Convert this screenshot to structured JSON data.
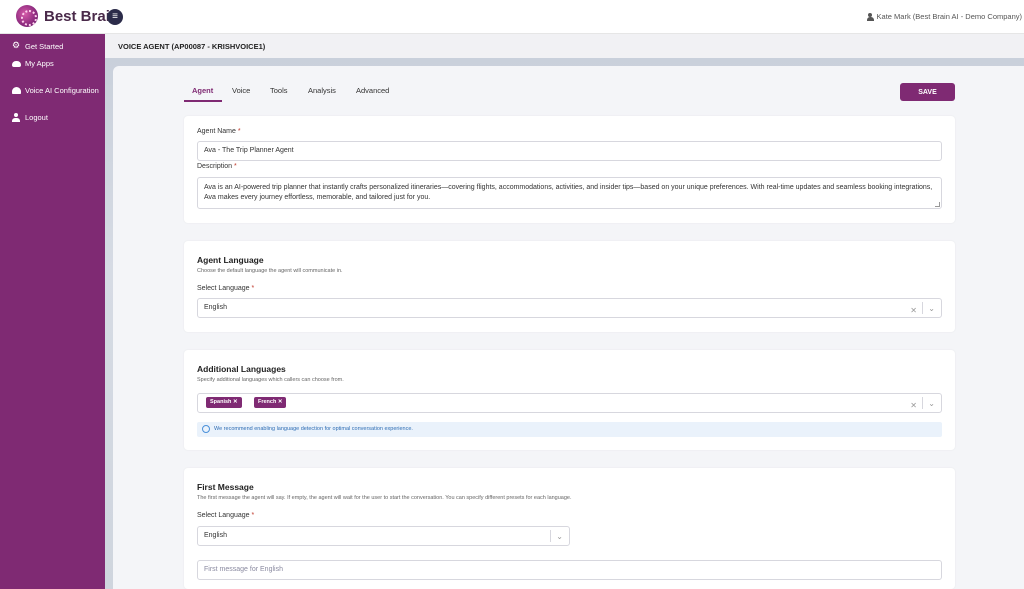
{
  "app": {
    "brand": "Best Brain",
    "user": "Kate Mark (Best Brain AI - Demo Company)"
  },
  "sidebar": {
    "items": [
      {
        "label": "Get Started",
        "icon": "gears-icon"
      },
      {
        "label": "My Apps",
        "icon": "apps-icon"
      },
      {
        "label": "Voice AI Configuration",
        "icon": "voice-icon"
      },
      {
        "label": "Logout",
        "icon": "user-icon"
      }
    ]
  },
  "header": {
    "title": "VOICE AGENT (AP00087 - KRISHVOICE1)"
  },
  "tabs": [
    {
      "label": "Agent",
      "active": true
    },
    {
      "label": "Voice"
    },
    {
      "label": "Tools"
    },
    {
      "label": "Analysis"
    },
    {
      "label": "Advanced"
    }
  ],
  "toolbar": {
    "save_label": "SAVE"
  },
  "agent": {
    "name_label": "Agent Name",
    "name_value": "Ava - The Trip  Planner Agent",
    "description_label": "Description",
    "description_value": "Ava is an AI-powered trip planner that instantly crafts personalized itineraries—covering flights, accommodations, activities, and insider tips—based on your unique preferences. With real-time updates and seamless booking integrations, Ava makes every journey effortless, memorable, and tailored just for you."
  },
  "agent_language": {
    "title": "Agent Language",
    "subtitle": "Choose the default language the agent will communicate in.",
    "select_label": "Select Language",
    "selected": "English"
  },
  "additional_languages": {
    "title": "Additional Languages",
    "subtitle": "Specify additional languages which callers can choose from.",
    "chips": [
      "Spanish",
      "French"
    ],
    "info": "We recommend enabling language detection for optimal conversation experience."
  },
  "first_message": {
    "title": "First Message",
    "subtitle": "The first message the agent will say. If empty, the agent will wait for the user to start the conversation. You can specify different presets for each language.",
    "select_label": "Select Language",
    "selected": "English",
    "placeholder": "First message for English"
  },
  "colors": {
    "brand": "#7f2a73",
    "info_bg": "#eaf2fb",
    "info_text": "#2e6db4"
  }
}
